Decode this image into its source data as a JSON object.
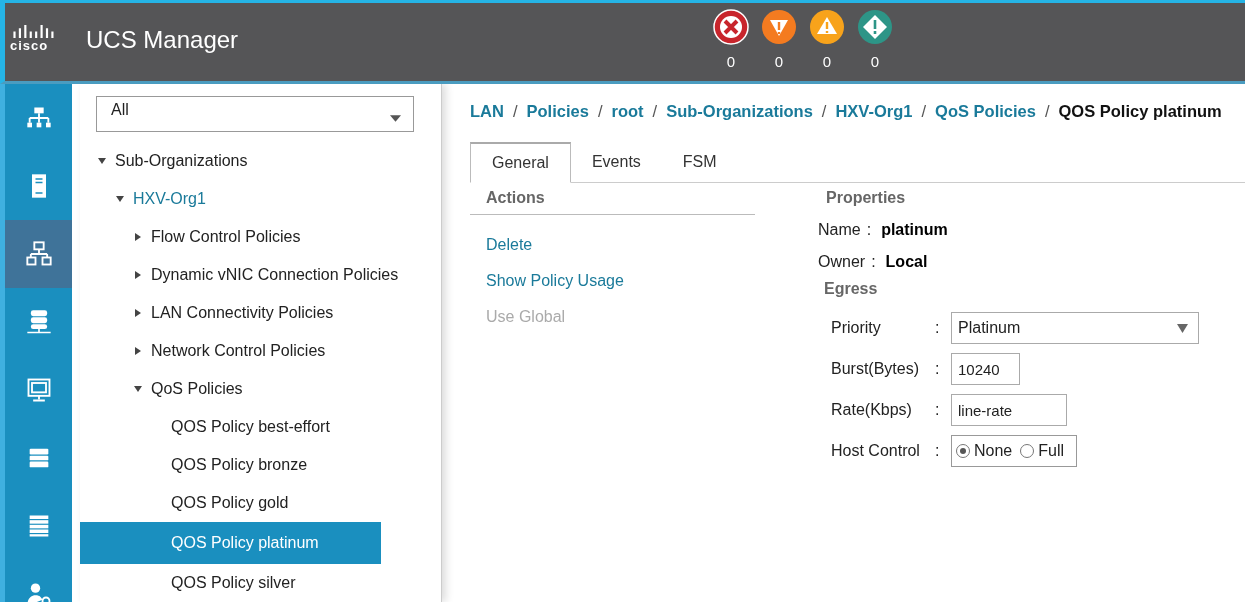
{
  "header": {
    "brand": "cisco",
    "title": "UCS Manager",
    "faults": [
      {
        "kind": "critical",
        "count": "0"
      },
      {
        "kind": "major",
        "count": "0"
      },
      {
        "kind": "minor",
        "count": "0"
      },
      {
        "kind": "warning",
        "count": "0"
      }
    ]
  },
  "nav": [
    {
      "kind": "equipment",
      "selected": false
    },
    {
      "kind": "servers",
      "selected": false
    },
    {
      "kind": "lan",
      "selected": true
    },
    {
      "kind": "san",
      "selected": false
    },
    {
      "kind": "vm",
      "selected": false
    },
    {
      "kind": "storage",
      "selected": false
    },
    {
      "kind": "chassis",
      "selected": false
    },
    {
      "kind": "admin",
      "selected": false
    }
  ],
  "filter": {
    "value": "All"
  },
  "tree": [
    {
      "label": "Sub-Organizations",
      "expanded": true,
      "selected": false,
      "children": [
        {
          "label": "HXV-Org1",
          "expanded": true,
          "selected": false,
          "kind": "org",
          "children": [
            {
              "label": "Flow Control Policies",
              "expanded": false,
              "selected": false
            },
            {
              "label": "Dynamic vNIC Connection Policies",
              "expanded": false,
              "selected": false
            },
            {
              "label": "LAN Connectivity Policies",
              "expanded": false,
              "selected": false
            },
            {
              "label": "Network Control Policies",
              "expanded": false,
              "selected": false
            },
            {
              "label": "QoS Policies",
              "expanded": true,
              "selected": false,
              "children": [
                {
                  "label": "QOS Policy best-effort",
                  "selected": false
                },
                {
                  "label": "QOS Policy bronze",
                  "selected": false
                },
                {
                  "label": "QOS Policy gold",
                  "selected": false
                },
                {
                  "label": "QOS Policy platinum",
                  "selected": true
                },
                {
                  "label": "QOS Policy silver",
                  "selected": false
                }
              ]
            }
          ]
        }
      ]
    }
  ],
  "breadcrumb": [
    {
      "label": "LAN"
    },
    {
      "sep": "/",
      "label": "Policies"
    },
    {
      "sep": "/",
      "label": "root"
    },
    {
      "sep": "/",
      "label": "Sub-Organizations"
    },
    {
      "sep": "/",
      "label": "HXV-Org1"
    },
    {
      "sep": "/",
      "label": "QoS Policies"
    },
    {
      "sep": "/",
      "label": "QOS Policy platinum"
    }
  ],
  "tabs": [
    {
      "label": "General",
      "selected": true
    },
    {
      "label": "Events",
      "selected": false
    },
    {
      "label": "FSM",
      "selected": false
    }
  ],
  "actions": {
    "title": "Actions",
    "items": [
      {
        "label": "Delete",
        "disabled": false
      },
      {
        "label": "Show Policy Usage",
        "disabled": false
      },
      {
        "label": "Use Global",
        "disabled": true
      }
    ]
  },
  "properties": {
    "title": "Properties",
    "fields": [
      {
        "label": "Name",
        "sep": ":",
        "value": "platinum"
      },
      {
        "label": "Owner",
        "sep": ":",
        "value": "Local"
      }
    ],
    "egress": {
      "title": "Egress",
      "fields": [
        {
          "kind": "select",
          "label": "Priority",
          "sep": ":",
          "value": "Platinum"
        },
        {
          "kind": "input",
          "label": "Burst(Bytes)",
          "sep": ":",
          "value": "10240"
        },
        {
          "kind": "input",
          "label": "Rate(Kbps)",
          "sep": ":",
          "value": "line-rate"
        },
        {
          "kind": "radio",
          "label": "Host Control",
          "sep": ":",
          "options": [
            {
              "label": "None",
              "selected": true
            },
            {
              "label": "Full",
              "selected": false
            }
          ]
        }
      ]
    }
  }
}
